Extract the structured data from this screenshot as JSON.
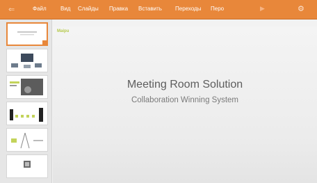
{
  "toolbar": {
    "menu": [
      "Файл",
      "Вид",
      "Слайды",
      "Правка",
      "Вставить",
      "Переходы",
      "Перо"
    ],
    "back_icon": "back-arrow-icon",
    "play_icon": "play-icon",
    "settings_icon": "gear-icon",
    "accent_color": "#e8873a"
  },
  "thumbnails": [
    {
      "slide": 1,
      "active": true
    },
    {
      "slide": 2,
      "active": false
    },
    {
      "slide": 3,
      "active": false
    },
    {
      "slide": 4,
      "active": false
    },
    {
      "slide": 5,
      "active": false
    },
    {
      "slide": 6,
      "active": false
    }
  ],
  "slide": {
    "logo_text": "Maipu",
    "title": "Meeting Room Solution",
    "subtitle": "Collaboration Winning System"
  }
}
